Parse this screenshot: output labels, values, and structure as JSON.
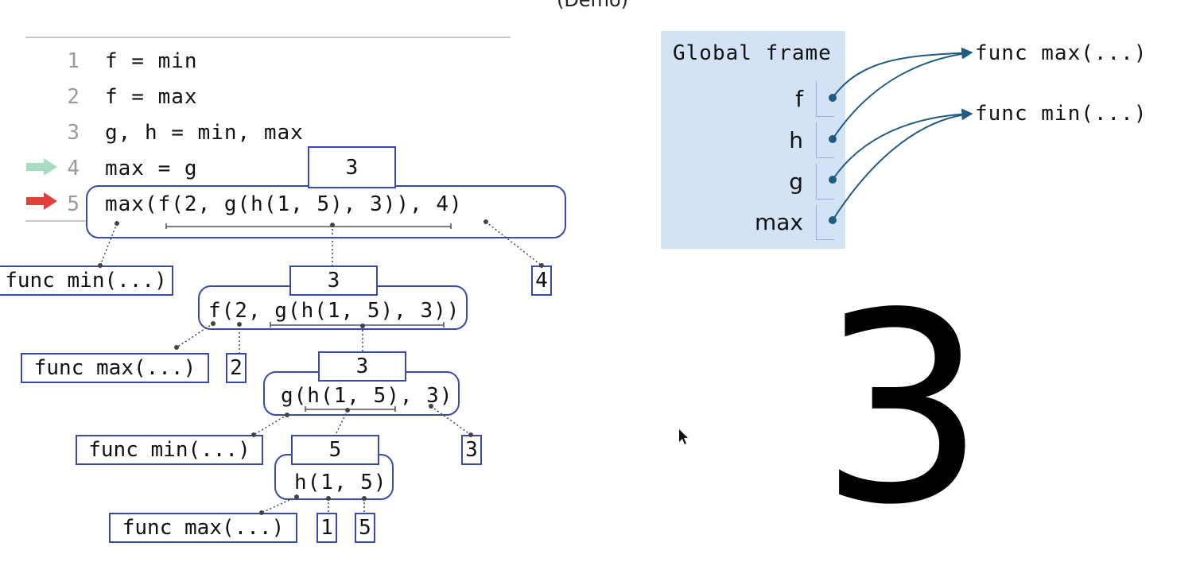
{
  "title_fragment": "(Demo)",
  "code": {
    "lines": [
      {
        "num": "1",
        "text": "f = min"
      },
      {
        "num": "2",
        "text": "f = max"
      },
      {
        "num": "3",
        "text": "g, h = min, max"
      },
      {
        "num": "4",
        "text": "max = g"
      },
      {
        "num": "5",
        "text": "max(f(2, g(h(1, 5), 3)), 4)"
      }
    ],
    "prev_arrow_color": "#a8dcc0",
    "next_arrow_color": "#e0413a"
  },
  "tree": {
    "root_value": "3",
    "root_operator": "func min(...)",
    "root_arg2": "4",
    "n1_value": "3",
    "n1_expr": "f(2, g(h(1, 5), 3))",
    "n1_operator": "func max(...)",
    "n1_arg1": "2",
    "n2_value": "3",
    "n2_expr": "g(h(1, 5), 3)",
    "n2_operator": "func min(...)",
    "n2_arg2": "3",
    "n3_value": "5",
    "n3_expr": "h(1, 5)",
    "n3_operator": "func max(...)",
    "n3_arg1": "1",
    "n3_arg2": "5"
  },
  "frame": {
    "title": "Global frame",
    "vars": [
      "f",
      "h",
      "g",
      "max"
    ],
    "objects": [
      "func max(...)",
      "func min(...)"
    ],
    "color": "#d3e2f5",
    "arrow_color": "#1f5b80"
  },
  "result": "3"
}
